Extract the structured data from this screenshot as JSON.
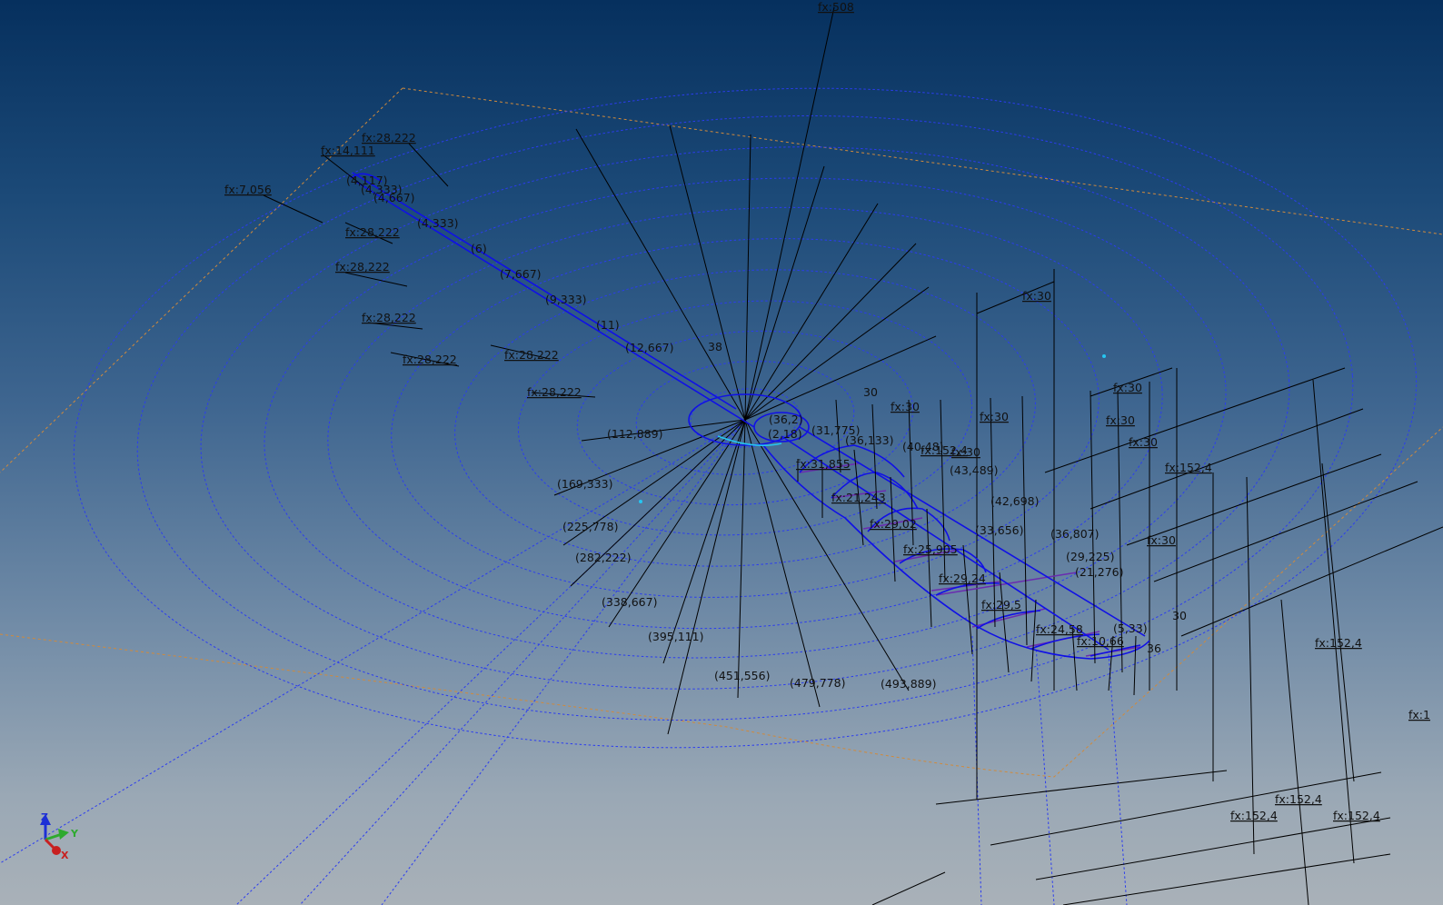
{
  "viewport": {
    "colors": {
      "blue_geometry": "#1010e6",
      "dashed_ellipse": "#2b3cf0",
      "orange_reference": "#d08a3c",
      "dimension_line": "#000000",
      "purple_profile": "#6a2bb0",
      "cyan_point": "#25c6f2"
    }
  },
  "dimensions": [
    {
      "id": "fx508",
      "text": "fx:508"
    },
    {
      "id": "fx28_top",
      "text": "fx:28,222"
    },
    {
      "id": "fx14",
      "text": "fx:14,111"
    },
    {
      "id": "fx7",
      "text": "fx:7,056"
    },
    {
      "id": "d4_117",
      "text": "(4,117)"
    },
    {
      "id": "d4_333",
      "text": "(4,333)"
    },
    {
      "id": "d4_667",
      "text": "(4,667)"
    },
    {
      "id": "d4_333b",
      "text": "(4,333)"
    },
    {
      "id": "fx28_a",
      "text": "fx:28,222"
    },
    {
      "id": "d6",
      "text": "(6)"
    },
    {
      "id": "fx28_b",
      "text": "fx:28,222"
    },
    {
      "id": "d7_667",
      "text": "(7,667)"
    },
    {
      "id": "d9_333",
      "text": "(9,333)"
    },
    {
      "id": "fx28_c",
      "text": "fx:28,222"
    },
    {
      "id": "d11",
      "text": "(11)"
    },
    {
      "id": "d12_667",
      "text": "(12,667)"
    },
    {
      "id": "fx28_d",
      "text": "fx:28,222"
    },
    {
      "id": "fx28_e",
      "text": "fx:28,222"
    },
    {
      "id": "d38",
      "text": "38"
    },
    {
      "id": "fx28_f",
      "text": "fx:28,222"
    },
    {
      "id": "d112",
      "text": "(112,889)"
    },
    {
      "id": "d169",
      "text": "(169,333)"
    },
    {
      "id": "d225",
      "text": "(225,778)"
    },
    {
      "id": "d282",
      "text": "(282,222)"
    },
    {
      "id": "d338",
      "text": "(338,667)"
    },
    {
      "id": "d395",
      "text": "(395,111)"
    },
    {
      "id": "d451",
      "text": "(451,556)"
    },
    {
      "id": "d479",
      "text": "(479,778)"
    },
    {
      "id": "d493",
      "text": "(493,889)"
    },
    {
      "id": "fx30_a",
      "text": "fx:30"
    },
    {
      "id": "d30_a",
      "text": "30"
    },
    {
      "id": "fx30_b",
      "text": "fx:30"
    },
    {
      "id": "fx30_c",
      "text": "fx:30"
    },
    {
      "id": "fx30_d",
      "text": "fx:30"
    },
    {
      "id": "fx30_e",
      "text": "fx:30"
    },
    {
      "id": "fx30_f",
      "text": "fx:30"
    },
    {
      "id": "fx30_g",
      "text": "fx:30"
    },
    {
      "id": "fx30_h",
      "text": "fx:30"
    },
    {
      "id": "d30_b",
      "text": "30"
    },
    {
      "id": "d31_775",
      "text": "(31,775)"
    },
    {
      "id": "d36_133",
      "text": "(36,133)"
    },
    {
      "id": "d40_48",
      "text": "(40,48)"
    },
    {
      "id": "d43_489",
      "text": "(43,489)"
    },
    {
      "id": "d42_698",
      "text": "(42,698)"
    },
    {
      "id": "d36_807",
      "text": "(36,807)"
    },
    {
      "id": "d29_225",
      "text": "(29,225)"
    },
    {
      "id": "d21_276",
      "text": "(21,276)"
    },
    {
      "id": "d36_2",
      "text": "(36,2)"
    },
    {
      "id": "d2_18",
      "text": "(2,18)"
    },
    {
      "id": "fx152_a",
      "text": "fx:152,4"
    },
    {
      "id": "fx152_b",
      "text": "fx:152,4"
    },
    {
      "id": "fx152_c",
      "text": "fx:152,4"
    },
    {
      "id": "fx152_d",
      "text": "fx:152,4"
    },
    {
      "id": "fx152_e",
      "text": "fx:152,4"
    },
    {
      "id": "fx152_f",
      "text": "fx:152,4"
    },
    {
      "id": "fx_cut",
      "text": "fx:1"
    },
    {
      "id": "sec1",
      "text": "fx:31,855"
    },
    {
      "id": "sec2",
      "text": "fx:21,243"
    },
    {
      "id": "sec3",
      "text": "fx:29,02"
    },
    {
      "id": "sec4",
      "text": "fx:25,905"
    },
    {
      "id": "sec5",
      "text": "fx:29,24"
    },
    {
      "id": "sec6",
      "text": "fx:29,5"
    },
    {
      "id": "sec7",
      "text": "fx:24,58"
    },
    {
      "id": "sec8",
      "text": "fx:10,66"
    },
    {
      "id": "d33_656",
      "text": "(33,656)"
    },
    {
      "id": "d36_tail",
      "text": "36"
    },
    {
      "id": "d5_33",
      "text": "(5,33)"
    }
  ],
  "triad": {
    "z_label": "Z",
    "y_label": "Y",
    "x_label": "X"
  }
}
